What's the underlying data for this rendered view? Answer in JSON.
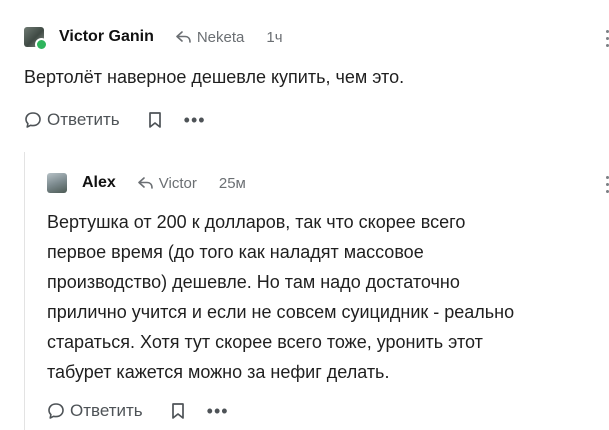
{
  "comments": [
    {
      "author": "Victor Ganin",
      "reply_to": "Neketa",
      "time": "1ч",
      "text": "Вертолёт наверное дешевле купить, чем это.",
      "reply_label": "Ответить",
      "online": true,
      "icons": {
        "reply": "reply-arrow-icon",
        "comment": "comment-bubble-icon",
        "bookmark": "bookmark-icon",
        "more": "more-dots-icon"
      }
    },
    {
      "author": "Alex",
      "reply_to": "Victor",
      "time": "25м",
      "text": "Вертушка от 200 к долларов, так что скорее всего\nпервое время (до того как наладят массовое\nпроизводство) дешевле. Но там надо достаточно\nприлично учится и если не совсем суицидник - реально\nстараться. Хотя тут скорее всего тоже, уронить этот\nтабурет кажется можно за нефиг делать.",
      "reply_label": "Ответить",
      "online": false
    }
  ],
  "colors": {
    "online": "#2fb55d",
    "muted": "#6b6f73",
    "text": "#1f1f1f"
  }
}
